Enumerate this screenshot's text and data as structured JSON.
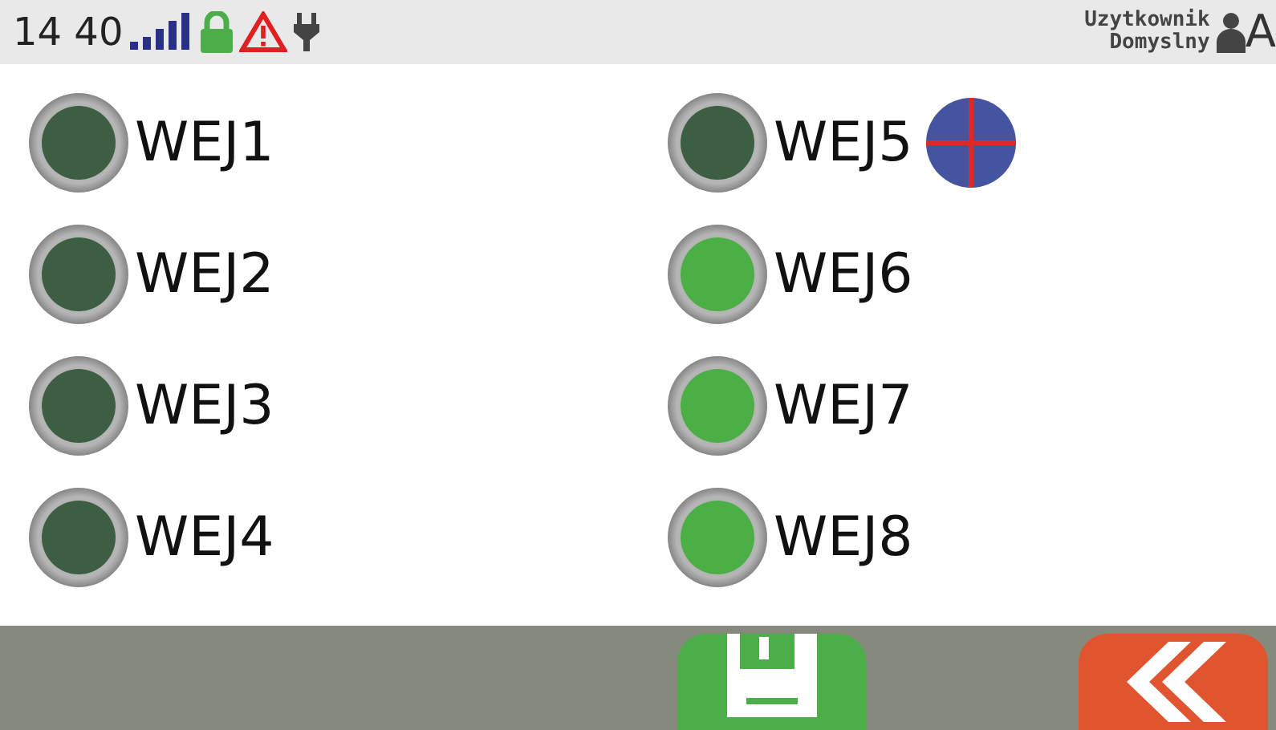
{
  "status_bar": {
    "time": "14 40",
    "user_line1": "Uzytkownik",
    "user_line2": "Domyslny",
    "cut_letter": "A"
  },
  "inputs": [
    {
      "label": "WEJ1",
      "on": false,
      "forced": false
    },
    {
      "label": "WEJ2",
      "on": false,
      "forced": false
    },
    {
      "label": "WEJ3",
      "on": false,
      "forced": false
    },
    {
      "label": "WEJ4",
      "on": false,
      "forced": false
    },
    {
      "label": "WEJ5",
      "on": false,
      "forced": true
    },
    {
      "label": "WEJ6",
      "on": true,
      "forced": false
    },
    {
      "label": "WEJ7",
      "on": true,
      "forced": false
    },
    {
      "label": "WEJ8",
      "on": true,
      "forced": false
    }
  ]
}
